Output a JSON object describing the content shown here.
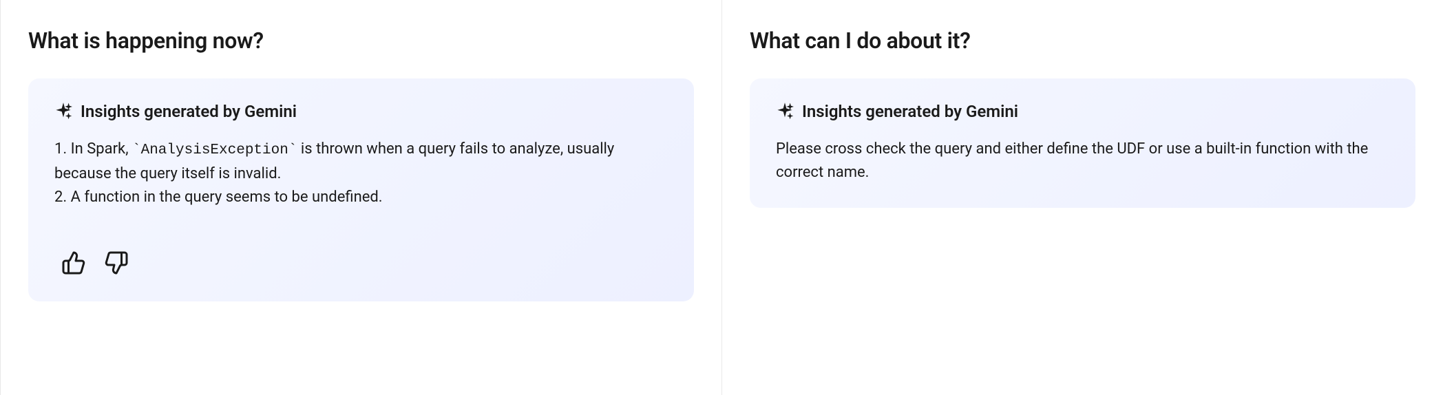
{
  "left": {
    "heading": "What is happening now?",
    "insight_title": "Insights generated by Gemini",
    "line1_prefix": "1. In Spark, ",
    "line1_code": "`AnalysisException`",
    "line1_suffix": " is thrown when a query fails to analyze, usually because the query itself is invalid.",
    "line2": "2. A function in the query seems to be undefined."
  },
  "right": {
    "heading": "What can I do about it?",
    "insight_title": "Insights generated by Gemini",
    "body": "Please cross check the query and either define the UDF or use a built-in function with the correct name."
  }
}
